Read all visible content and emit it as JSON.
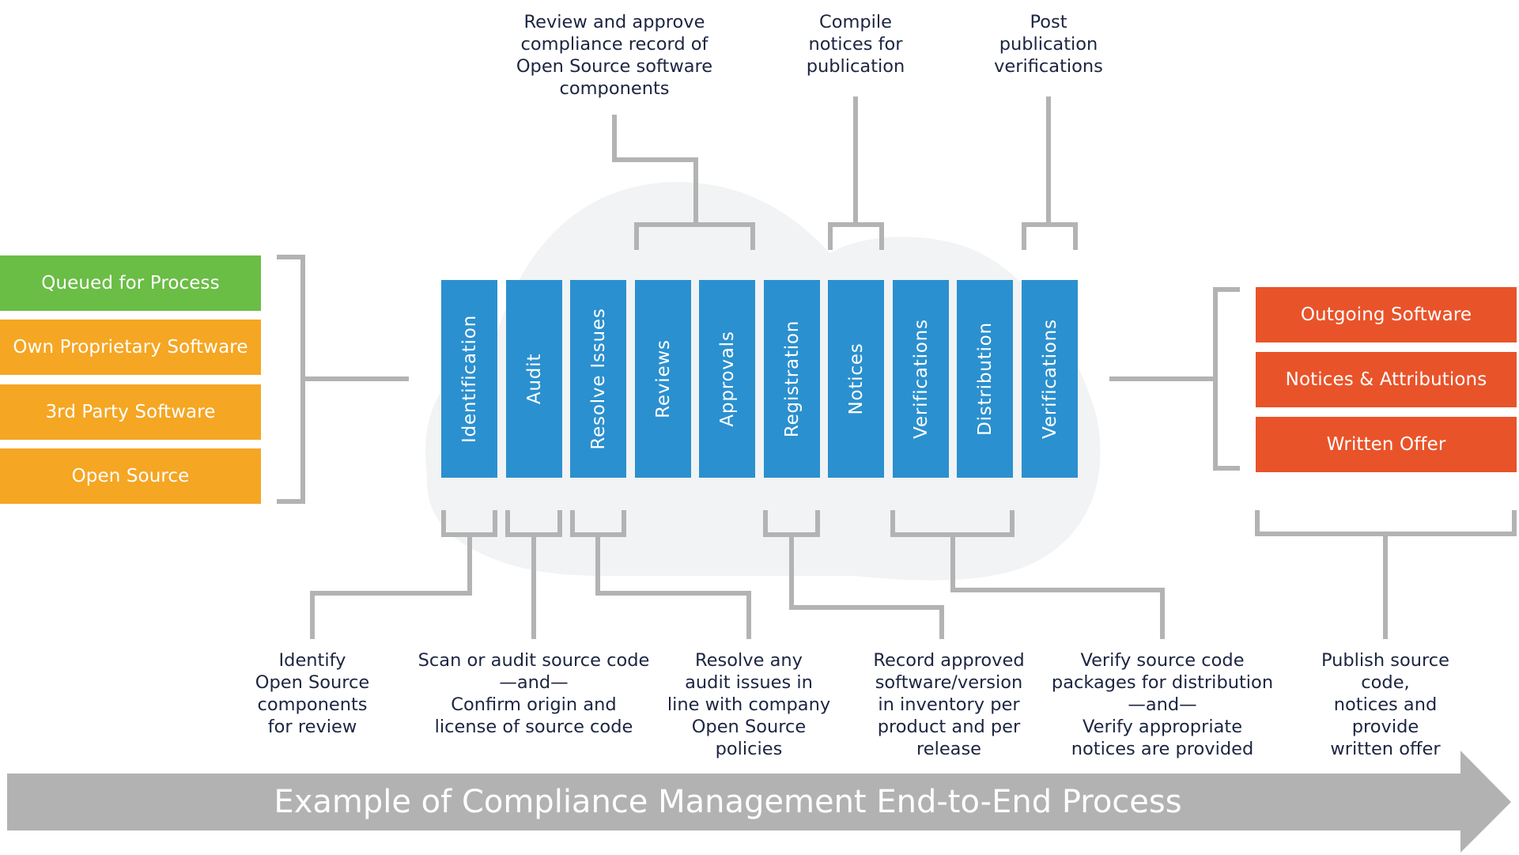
{
  "colors": {
    "green": "#6abd45",
    "orange": "#f5a623",
    "red_orange": "#e9532a",
    "blue": "#2b90cf",
    "connector_gray": "#b3b3b3",
    "cloud": "#f1f3f4",
    "banner": "#b2b2b2",
    "text": "#1c2541"
  },
  "inputs": {
    "items": [
      {
        "label": "Queued for Process",
        "color": "green"
      },
      {
        "label": "Own Proprietary Software",
        "color": "orange"
      },
      {
        "label": "3rd Party Software",
        "color": "orange"
      },
      {
        "label": "Open Source",
        "color": "orange"
      }
    ]
  },
  "stages": [
    {
      "label": "Identification"
    },
    {
      "label": "Audit"
    },
    {
      "label": "Resolve Issues"
    },
    {
      "label": "Reviews"
    },
    {
      "label": "Approvals"
    },
    {
      "label": "Registration"
    },
    {
      "label": "Notices"
    },
    {
      "label": "Verifications"
    },
    {
      "label": "Distribution"
    },
    {
      "label": "Verifications"
    }
  ],
  "outputs": {
    "items": [
      {
        "label": "Outgoing Software"
      },
      {
        "label": "Notices & Attributions"
      },
      {
        "label": "Written Offer"
      }
    ]
  },
  "top_notes": [
    {
      "text": "Review and approve\ncompliance record of\nOpen Source software\ncomponents",
      "stages": [
        "Reviews",
        "Approvals"
      ]
    },
    {
      "text": "Compile\nnotices for\npublication",
      "stages": [
        "Notices"
      ]
    },
    {
      "text": "Post\npublication\nverifications",
      "stages": [
        "Verifications"
      ]
    }
  ],
  "bottom_notes": [
    {
      "text": "Identify\nOpen Source\ncomponents\nfor review",
      "stages": [
        "Identification"
      ]
    },
    {
      "text": "Scan or audit source code\n—and—\nConfirm origin and\nlicense of source code",
      "stages": [
        "Audit"
      ]
    },
    {
      "text": "Resolve any\naudit issues in\nline with company\nOpen Source\npolicies",
      "stages": [
        "Resolve Issues"
      ]
    },
    {
      "text": "Record approved\nsoftware/version\nin inventory per\nproduct and per\nrelease",
      "stages": [
        "Registration"
      ]
    },
    {
      "text": "Verify source code\npackages for distribution\n—and—\nVerify appropriate\nnotices are provided",
      "stages": [
        "Verifications",
        "Distribution"
      ]
    },
    {
      "text": "Publish source code,\nnotices and provide\nwritten offer",
      "stages": [
        "Outgoing Software",
        "Notices & Attributions",
        "Written Offer"
      ]
    }
  ],
  "banner": {
    "title": "Example of Compliance Management End-to-End Process"
  }
}
